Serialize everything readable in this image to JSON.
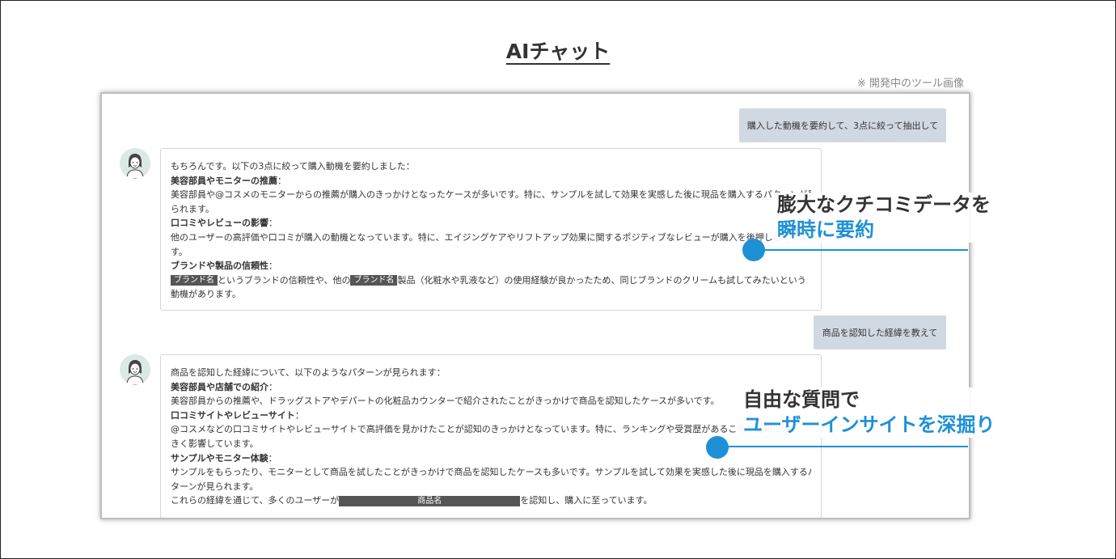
{
  "title": "AIチャット",
  "dev_note": "※ 開発中のツール画像",
  "chat": {
    "user_message_1": "購入した動機を要約して、3点に絞って抽出して",
    "ai_response_1": {
      "intro": "もちろんです。以下の3点に絞って購入動機を要約しました：",
      "h1": "美容部員やモニターの推薦",
      "h1_colon": "：",
      "p1_a": "美容部員や@コスメのモニターからの推薦が購入のきっかけとなったケースが多いです。特に、サンプルを試して効果を実感した後に現品を購入するパターンが見",
      "p1_b": "られます。",
      "h2": "口コミやレビューの影響",
      "h2_colon": "：",
      "p2_a": "他のユーザーの高評価や口コミが購入の動機となっています。特に、エイジングケアやリフトアップ効果に関するポジティブなレビューが購入を後押ししていま",
      "p2_b": "す。",
      "h3": "ブランドや製品の信頼性",
      "h3_colon": "：",
      "p3_brand_1": "ブランド名",
      "p3_mid": "というブランドの信頼性や、他の",
      "p3_brand_2": "ブランド名",
      "p3_end": "製品（化粧水や乳液など）の使用経験が良かったため、同じブランドのクリームも試してみたいという",
      "p3_b": "動機があります。"
    },
    "user_message_2": "商品を認知した経緯を教えて",
    "ai_response_2": {
      "intro": "商品を認知した経緯について、以下のようなパターンが見られます：",
      "h1": "美容部員や店舗での紹介",
      "h1_colon": "：",
      "p1": "美容部員からの推薦や、ドラッグストアやデパートの化粧品カウンターで紹介されたことがきっかけで商品を認知したケースが多いです。",
      "h2": "口コミサイトやレビューサイト",
      "h2_colon": "：",
      "p2_a": "@コスメなどの口コミサイトやレビューサイトで高評価を見かけたことが認知のきっかけとなっています。特に、ランキングや受賞歴があることが認知に大",
      "p2_b": "きく影響しています。",
      "h3": "サンプルやモニター体験",
      "h3_colon": "：",
      "p3_a": "サンプルをもらったり、モニターとして商品を試したことがきっかけで商品を認知したケースも多いです。サンプルを試して効果を実感した後に現品を購入するパ",
      "p3_b": "ターンが見られます。",
      "p4_start": "これらの経緯を通じて、多くのユーザーが",
      "p4_product": "商品名",
      "p4_end": "を認知し、購入に至っています。"
    }
  },
  "callouts": {
    "c1_line1": "膨大なクチコミデータを",
    "c1_line2": "瞬時に要約",
    "c2_line1": "自由な質問で",
    "c2_line2": "ユーザーインサイトを深掘り"
  },
  "colors": {
    "accent": "#1e90d6",
    "user_bubble": "#d0d8e2",
    "redaction": "#555555"
  }
}
